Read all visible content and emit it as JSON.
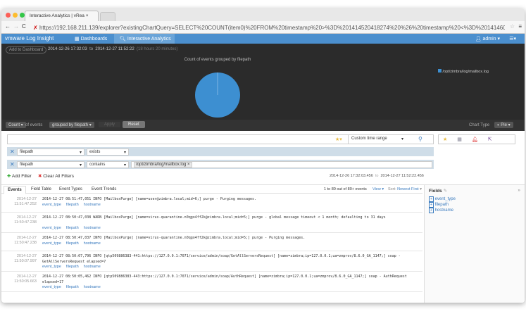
{
  "browser": {
    "tab_title": "Interactive Analytics | vRea",
    "url_scheme": "https",
    "url": "https://192.168.211.139/explorer?existingChartQuery=SELECT%20COUNT(item0)%20FROM%20timestamp%20>%3D%201414520418274%20%26%20timestamp%20<%3D%201414606818..."
  },
  "nav": {
    "brand": "vmware Log Insight",
    "dashboards": "Dashboards",
    "interactive": "Interactive Analytics",
    "user": "admin"
  },
  "toolbar": {
    "add_to_dashboard": "Add to Dashboard",
    "from": "2014-12-26  17:32:03",
    "to_word": "to",
    "to": "2014-12-27  11:52:22",
    "duration": "(18 hours 20 minutes)"
  },
  "chart_data": {
    "type": "pie",
    "title": "Count of events grouped by filepath",
    "categories": [
      "/opt/zimbra/log/mailbox.log"
    ],
    "values": [
      100
    ],
    "colors": [
      "#3d8fd1"
    ]
  },
  "controls": {
    "count": "Count",
    "of_events": "of events",
    "grouped": "grouped by filepath",
    "apply": "Apply",
    "reset": "Reset",
    "chart_type_label": "Chart Type",
    "chart_type": "Pie"
  },
  "search": {
    "value": "",
    "time_range": "Custom time range"
  },
  "filters": [
    {
      "field": "filepath",
      "op": "exists",
      "value": ""
    },
    {
      "field": "filepath",
      "op": "contains",
      "value": "/opt/zimbra/log/mailbox.log"
    }
  ],
  "filter_actions": {
    "add": "Add Filter",
    "clear": "Clear All Filters",
    "range_from": "2014-12-26 17:32:03.456",
    "to_word": "to",
    "range_to": "2014-12-27 11:52:22.456"
  },
  "tabs": [
    "Events",
    "Field Table",
    "Event Types",
    "Event Trends"
  ],
  "results": {
    "count": "1 to 80 out of 80+ events",
    "view": "View",
    "sort_label": "Sort:",
    "sort": "Newest First"
  },
  "events": [
    {
      "date": "2014-12-27",
      "time": "11:51:47.252",
      "msg": "2014-12-27 08:51:47,051 INFO  [MailboxPurge] [name=user@zimbra.local;mid=6;] purge - Purging messages."
    },
    {
      "date": "2014-12-27",
      "time": "11:50:47.238",
      "msg": "2014-12-27 08:50:47,038 WARN  [MailboxPurge] [name=virus-quarantine.n0qgo4ff2k@zimbra.local;mid=5;] purge - global message timeout < 1 month; defaulting to 31 days"
    },
    {
      "date": "2014-12-27",
      "time": "11:50:47.238",
      "msg": "2014-12-27 08:50:47,037 INFO  [MailboxPurge] [name=virus-quarantine.n0qgo4ff2k@zimbra.local;mid=5;] purge - Purging messages."
    },
    {
      "date": "2014-12-27",
      "time": "11:50:07.997",
      "msg": "2014-12-27 08:50:07,796 INFO  [qtp509886383-441:https://127.0.0.1:7071/service/admin/soap/GetAllServersRequest] [name=zimbra;ip=127.0.0.1;ua=zmprov/8.6.0_GA_1147;] soap - GetAllServersRequest elapsed=7"
    },
    {
      "date": "2014-12-27",
      "time": "11:50:05.663",
      "msg": "2014-12-27 08:50:05,462 INFO  [qtp509886383-443:https://127.0.0.1:7071/service/admin/soap/AuthRequest] [name=zimbra;ip=127.0.0.1;ua=zmprov/8.6.0_GA_1147;] soap - AuthRequest elapsed=17"
    }
  ],
  "event_links": [
    "event_type",
    "filepath",
    "hostname"
  ],
  "fields": {
    "title": "Fields",
    "items": [
      "event_type",
      "filepath",
      "hostname"
    ]
  }
}
